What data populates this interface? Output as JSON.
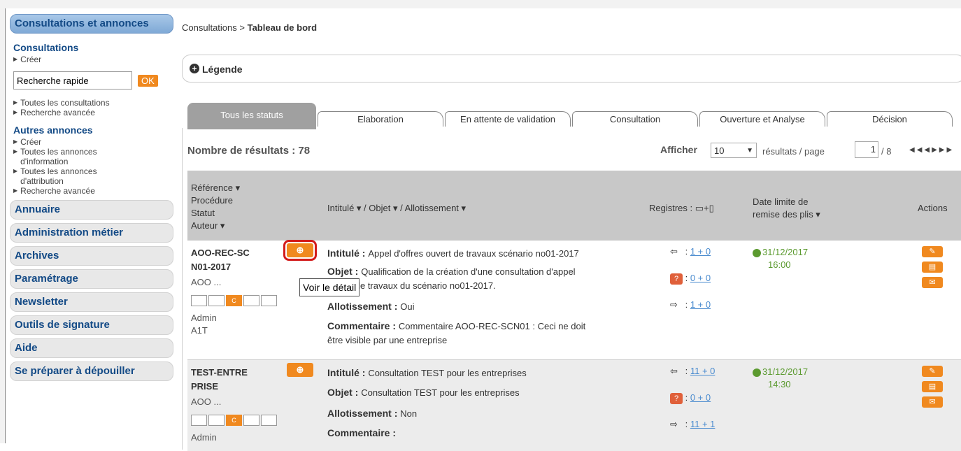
{
  "sidebar": {
    "header": "Consultations et annonces",
    "consultations": {
      "title": "Consultations",
      "create": "Créer",
      "quick_search_value": "Recherche rapide",
      "ok": "OK",
      "all": "Toutes les consultations",
      "advanced": "Recherche avancée"
    },
    "autres": {
      "title": "Autres annonces",
      "create": "Créer",
      "info_line1": "Toutes les annonces",
      "info_line2": "d'information",
      "attr_line1": "Toutes les annonces",
      "attr_line2": "d'attribution",
      "advanced": "Recherche avancée"
    },
    "menu": [
      "Annuaire",
      "Administration métier",
      "Archives",
      "Paramétrage",
      "Newsletter",
      "Outils de signature",
      "Aide",
      "Se préparer à dépouiller"
    ]
  },
  "breadcrumb": {
    "part1": "Consultations > ",
    "part2": "Tableau de bord"
  },
  "legend": {
    "label": "Légende"
  },
  "tabs": [
    "Tous les statuts",
    "Elaboration",
    "En attente de validation",
    "Consultation",
    "Ouverture et Analyse",
    "Décision"
  ],
  "results": {
    "count_label": "Nombre de résultats : 78",
    "show_label": "Afficher",
    "per_page": "10",
    "per_page_suffix": "résultats / page",
    "page": "1",
    "page_total": "/ 8"
  },
  "table_header": {
    "col1_l1": "Référence ▾",
    "col1_l2": "Procédure",
    "col1_l3": "Statut",
    "col1_l4": "Auteur ▾",
    "col2": "Intitulé ▾ / Objet ▾ / Allotissement ▾",
    "col3": "Registres :",
    "col4_l1": "Date limite de",
    "col4_l2": "remise des plis ▾",
    "col5": "Actions"
  },
  "rows": [
    {
      "ref_l1": "AOO-REC-SC",
      "ref_l2": "N01-2017",
      "procedure": "AOO ...",
      "author": "Admin",
      "author2": "A1T",
      "intitule_label": "Intitulé : ",
      "intitule": "Appel d'offres ouvert de travaux scénario no01-2017",
      "objet_label": "Objet : ",
      "objet_l1": "Qualification de la création d'une consultation d'appel",
      "objet_l2": "ouvert de travaux du scénario no01-2017.",
      "allot_label": "Allotissement : ",
      "allot": "Oui",
      "comment_label": "Commentaire : ",
      "comment_l1": "Commentaire AOO-REC-SCN01 : Ceci ne doit",
      "comment_l2": "être visible par une entreprise",
      "reg1": "1 + 0",
      "reg2": "0 + 0",
      "reg3": "1 + 0",
      "date": "31/12/2017",
      "time": "16:00"
    },
    {
      "ref_l1": "TEST-ENTRE",
      "ref_l2": "PRISE",
      "procedure": "AOO ...",
      "author": "Admin",
      "intitule_label": "Intitulé : ",
      "intitule": "Consultation TEST pour les entreprises",
      "objet_label": "Objet : ",
      "objet_l1": "Consultation TEST pour les entreprises",
      "allot_label": "Allotissement : ",
      "allot": "Non",
      "comment_label": "Commentaire : ",
      "reg1": "11 + 0",
      "reg2": "0 + 0",
      "reg3": "11 + 1",
      "date": "31/12/2017",
      "time": "14:30"
    }
  ],
  "tooltip": "Voir le détail",
  "colors": {
    "accent": "#f0891f",
    "nav_blue": "#134a86",
    "link": "#4a8bcf",
    "date_green": "#5b9a2f",
    "highlight": "#d31c1c"
  }
}
